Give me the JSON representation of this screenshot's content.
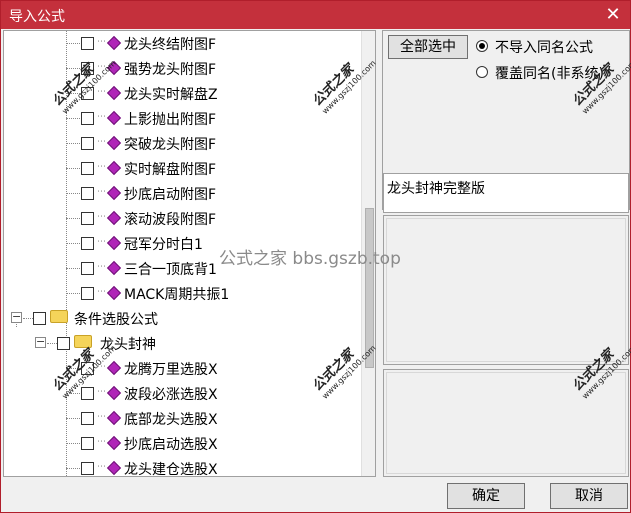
{
  "window": {
    "title": "导入公式",
    "close_glyph": "✕"
  },
  "tree": {
    "formula_items": [
      "龙头终结附图F",
      "强势龙头附图F",
      "龙头实时解盘Z",
      "上影抛出附图F",
      "突破龙头附图F",
      "实时解盘附图F",
      "抄底启动附图F",
      "滚动波段附图F",
      "冠军分时白1",
      "三合一顶底背1",
      "MACK周期共振1"
    ],
    "category": "条件选股公式",
    "subcategory": "龙头封神",
    "select_items": [
      "龙腾万里选股X",
      "波段必涨选股X",
      "底部龙头选股X",
      "抄底启动选股X",
      "龙头建仓选股X"
    ],
    "expander_collapse": "−"
  },
  "right": {
    "select_all": "全部选中",
    "radio_no_import": "不导入同名公式",
    "radio_overwrite": "覆盖同名(非系统)",
    "description": "龙头封神完整版"
  },
  "buttons": {
    "ok": "确定",
    "cancel": "取消"
  },
  "watermarks": {
    "brand": "公式之家",
    "site": "www.gszj100.com",
    "center": "公式之家 bbs.gszb.top"
  },
  "colors": {
    "titlebar": "#c4303c",
    "gem": "#b026b8",
    "folder": "#f5d45a"
  }
}
